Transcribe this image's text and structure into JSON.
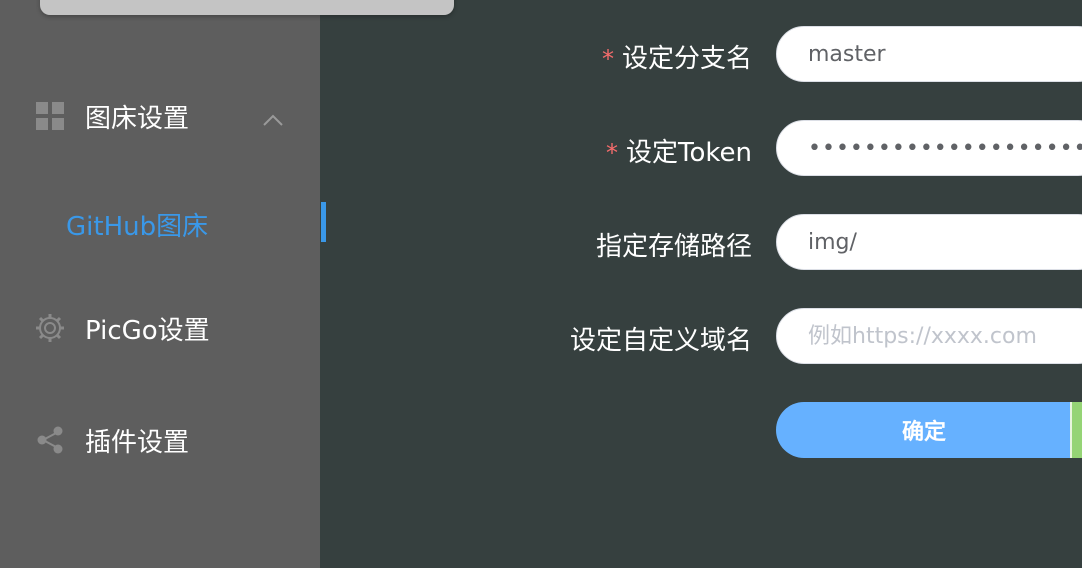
{
  "sidebar": {
    "items": [
      {
        "label": "图床设置",
        "icon": "grid-icon",
        "expanded": true
      },
      {
        "label": "PicGo设置",
        "icon": "gear-icon"
      },
      {
        "label": "插件设置",
        "icon": "share-icon"
      }
    ],
    "sub_items": [
      {
        "label": "GitHub图床",
        "active": true
      }
    ]
  },
  "form": {
    "fields": [
      {
        "label": "设定分支名",
        "required": true,
        "value": "master",
        "placeholder": ""
      },
      {
        "label": "设定Token",
        "required": true,
        "value": "••••••••••••••••••••••••••••",
        "placeholder": ""
      },
      {
        "label": "指定存储路径",
        "required": false,
        "value": "img/",
        "placeholder": ""
      },
      {
        "label": "设定自定义域名",
        "required": false,
        "value": "",
        "placeholder": "例如https://xxxx.com"
      }
    ],
    "confirm_label": "确定"
  },
  "colors": {
    "sidebar_bg": "#5e5e5e",
    "main_bg": "#36403f",
    "accent": "#3a98e8",
    "button": "#66b1ff",
    "required": "#f56c6c"
  }
}
